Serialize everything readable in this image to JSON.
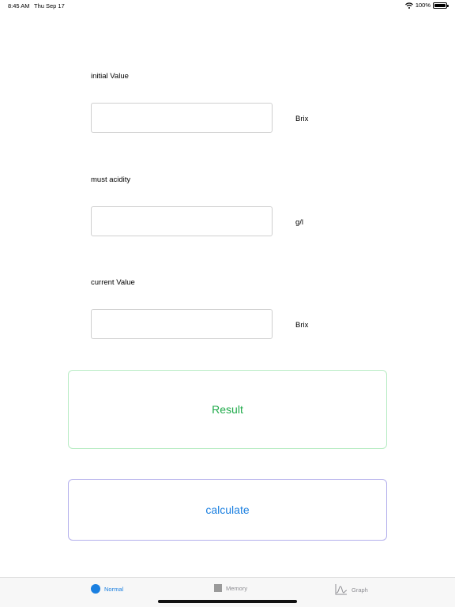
{
  "status_bar": {
    "time": "8:45 AM",
    "date": "Thu Sep 17",
    "battery": "100%"
  },
  "form": {
    "initial": {
      "label": "initial Value",
      "value": "",
      "unit": "Brix"
    },
    "acidity": {
      "label": "must acidity",
      "value": "",
      "unit": "g/l"
    },
    "current": {
      "label": "current Value",
      "value": "",
      "unit": "Brix"
    }
  },
  "result": {
    "text": "Result",
    "color": "#1faa4a"
  },
  "calculate": {
    "label": "calculate",
    "color": "#1a7fe0"
  },
  "tabbar": {
    "tabs": [
      {
        "label": "Normal",
        "icon": "circle-icon",
        "selected": true
      },
      {
        "label": "Memory",
        "icon": "square-icon",
        "selected": false
      },
      {
        "label": "Graph",
        "icon": "graph-icon",
        "selected": false
      }
    ]
  }
}
